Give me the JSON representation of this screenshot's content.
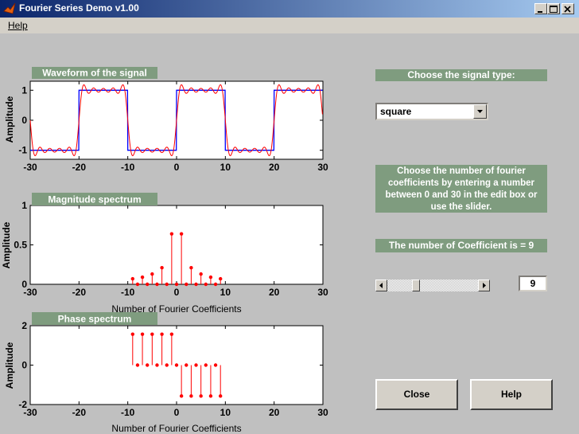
{
  "window": {
    "title": "Fourier Series Demo v1.00"
  },
  "menu": {
    "help": "Help"
  },
  "panels": {
    "signal_type_label": "Choose the signal type:",
    "signal_type_value": "square",
    "instructions": "Choose the number of fourier coefficients by entering a number between 0 and 30 in the edit box or use the slider.",
    "coef_label": "The number of Coefficient is = 9",
    "coef_value": "9",
    "slider_value": 9,
    "slider_range": [
      0,
      30
    ],
    "close_button": "Close",
    "help_button": "Help"
  },
  "colors": {
    "panel_green": "#7f9c7f",
    "square_wave": "#0000ff",
    "fourier_approx": "#ff0000"
  },
  "chart_data": [
    {
      "type": "line",
      "title": "Waveform of the signal",
      "ylabel": "Amplitude",
      "xlim": [
        -30,
        30
      ],
      "ylim": [
        -1.3,
        1.3
      ],
      "xticks": [
        "-30",
        "-20",
        "-10",
        "0",
        "10",
        "20",
        "30"
      ],
      "yticks": [
        "1",
        "0",
        "-1"
      ],
      "period": 20,
      "harmonics": 9,
      "series": [
        {
          "kind": "square",
          "amplitude": 1
        },
        {
          "kind": "fourier",
          "amplitude": 1
        }
      ]
    },
    {
      "type": "stem",
      "title": "Magnitude spectrum",
      "ylabel": "Amplitude",
      "xlabel": "Number of Fourier Coefficients",
      "xlim": [
        -30,
        30
      ],
      "ylim": [
        0,
        1
      ],
      "xticks": [
        "-30",
        "-20",
        "-10",
        "0",
        "10",
        "20",
        "30"
      ],
      "yticks": [
        "1",
        "0.5",
        "0"
      ],
      "x": [
        -9,
        -8,
        -7,
        -6,
        -5,
        -4,
        -3,
        -2,
        -1,
        0,
        1,
        2,
        3,
        4,
        5,
        6,
        7,
        8,
        9
      ],
      "values": [
        0.07,
        0,
        0.09,
        0,
        0.13,
        0,
        0.21,
        0,
        0.64,
        0,
        0.64,
        0,
        0.21,
        0,
        0.13,
        0,
        0.09,
        0,
        0.07
      ]
    },
    {
      "type": "stem",
      "title": "Phase spectrum",
      "ylabel": "Amplitude",
      "xlabel": "Number of Fourier Coefficients",
      "xlim": [
        -30,
        30
      ],
      "ylim": [
        -2,
        2
      ],
      "xticks": [
        "-30",
        "-20",
        "-10",
        "0",
        "10",
        "20",
        "30"
      ],
      "yticks": [
        "2",
        "0",
        "-2"
      ],
      "x": [
        -9,
        -8,
        -7,
        -6,
        -5,
        -4,
        -3,
        -2,
        -1,
        0,
        1,
        2,
        3,
        4,
        5,
        6,
        7,
        8,
        9
      ],
      "values": [
        1.57,
        0,
        1.57,
        0,
        1.57,
        0,
        1.57,
        0,
        1.57,
        0,
        -1.57,
        0,
        -1.57,
        0,
        -1.57,
        0,
        -1.57,
        0,
        -1.57
      ]
    }
  ]
}
